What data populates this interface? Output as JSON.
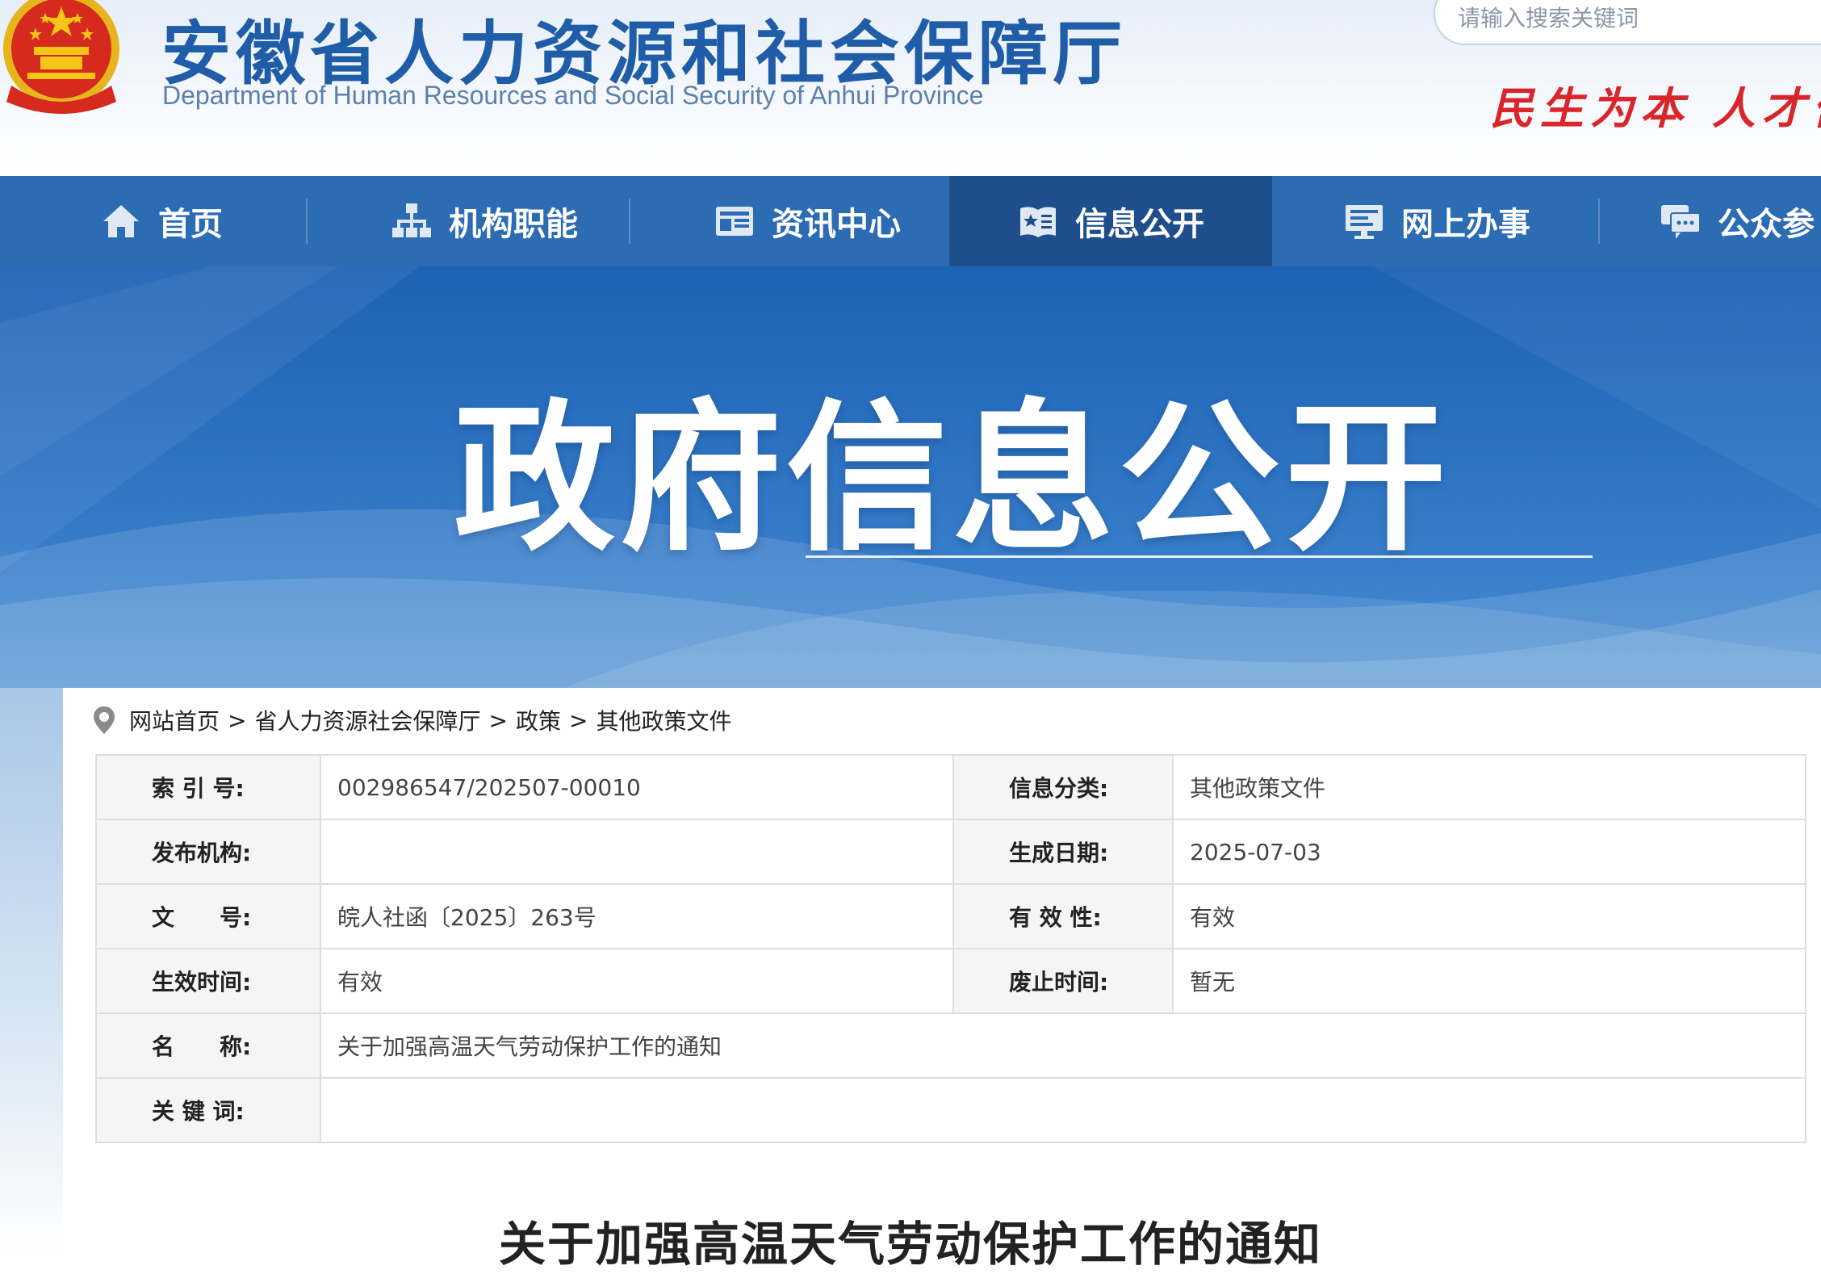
{
  "header": {
    "title": "安徽省人力资源和社会保障厅",
    "subtitle": "Department of Human Resources and Social Security of Anhui Province",
    "search_placeholder": "请输入搜索关键词",
    "slogan": "民生为本  人才优"
  },
  "nav": {
    "items": [
      {
        "label": "首页",
        "icon": "home-icon"
      },
      {
        "label": "机构职能",
        "icon": "org-chart-icon"
      },
      {
        "label": "资讯中心",
        "icon": "news-icon"
      },
      {
        "label": "信息公开",
        "icon": "book-star-icon",
        "active": true
      },
      {
        "label": "网上办事",
        "icon": "monitor-icon"
      },
      {
        "label": "公众参",
        "icon": "chat-icon"
      }
    ]
  },
  "banner": {
    "title": "政府信息公开"
  },
  "breadcrumb": [
    "网站首页",
    "省人力资源社会保障厅",
    "政策",
    "其他政策文件"
  ],
  "breadcrumb_separator": ">",
  "meta": {
    "index_label": "索 引 号:",
    "index_value": "002986547/202507-00010",
    "category_label": "信息分类:",
    "category_value": "其他政策文件",
    "publisher_label": "发布机构:",
    "publisher_value": "",
    "date_label": "生成日期:",
    "date_value": "2025-07-03",
    "doc_no_label": "文　　号:",
    "doc_no_value": "皖人社函〔2025〕263号",
    "validity_label": "有 效 性:",
    "validity_value": "有效",
    "effective_label": "生效时间:",
    "effective_value": "有效",
    "abolish_label": "废止时间:",
    "abolish_value": "暂无",
    "name_label": "名　　称:",
    "name_value": "关于加强高温天气劳动保护工作的通知",
    "keywords_label": "关 键 词:",
    "keywords_value": ""
  },
  "article": {
    "title": "关于加强高温天气劳动保护工作的通知"
  },
  "colors": {
    "brand_blue": "#2c6cb3",
    "nav_active": "#1e4f8c",
    "slogan_red": "#d9262a"
  }
}
